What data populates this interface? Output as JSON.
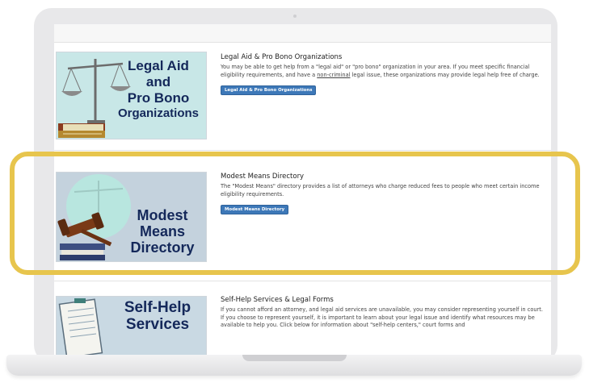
{
  "colors": {
    "highlight": "#e7c54d",
    "button": "#3d78b8",
    "thumb_text": "#14285a"
  },
  "sections": [
    {
      "thumb_lines": [
        "Legal Aid",
        "and",
        "Pro Bono",
        "Organizations"
      ],
      "title": "Legal Aid & Pro Bono Organizations",
      "desc_before": "You may be able to get help from a \"legal aid\" or \"pro bono\" organization in your area. If you meet specific financial eligibility requirements, and have a ",
      "desc_link": "non-criminal",
      "desc_after": " legal issue, these organizations may provide legal help free of charge.",
      "button": "Legal Aid & Pro Bono Organizations",
      "icon": "scales-of-justice-icon"
    },
    {
      "thumb_lines": [
        "Modest",
        "Means",
        "Directory"
      ],
      "title": "Modest Means Directory",
      "desc": "The \"Modest Means\" directory provides a list of attorneys who charge reduced fees to people who meet certain income eligibility requirements.",
      "button": "Modest Means Directory",
      "icon": "gavel-icon"
    },
    {
      "thumb_lines": [
        "Self-Help",
        "Services"
      ],
      "title": "Self-Help Services & Legal Forms",
      "desc": "If you cannot afford an attorney, and legal aid services are unavailable, you may consider representing yourself in court. If you choose to represent yourself, it is important to learn about your legal issue and identify what resources may be available to help you. Click below for information about \"self-help centers,\" court forms and",
      "icon": "notepad-icon"
    }
  ]
}
